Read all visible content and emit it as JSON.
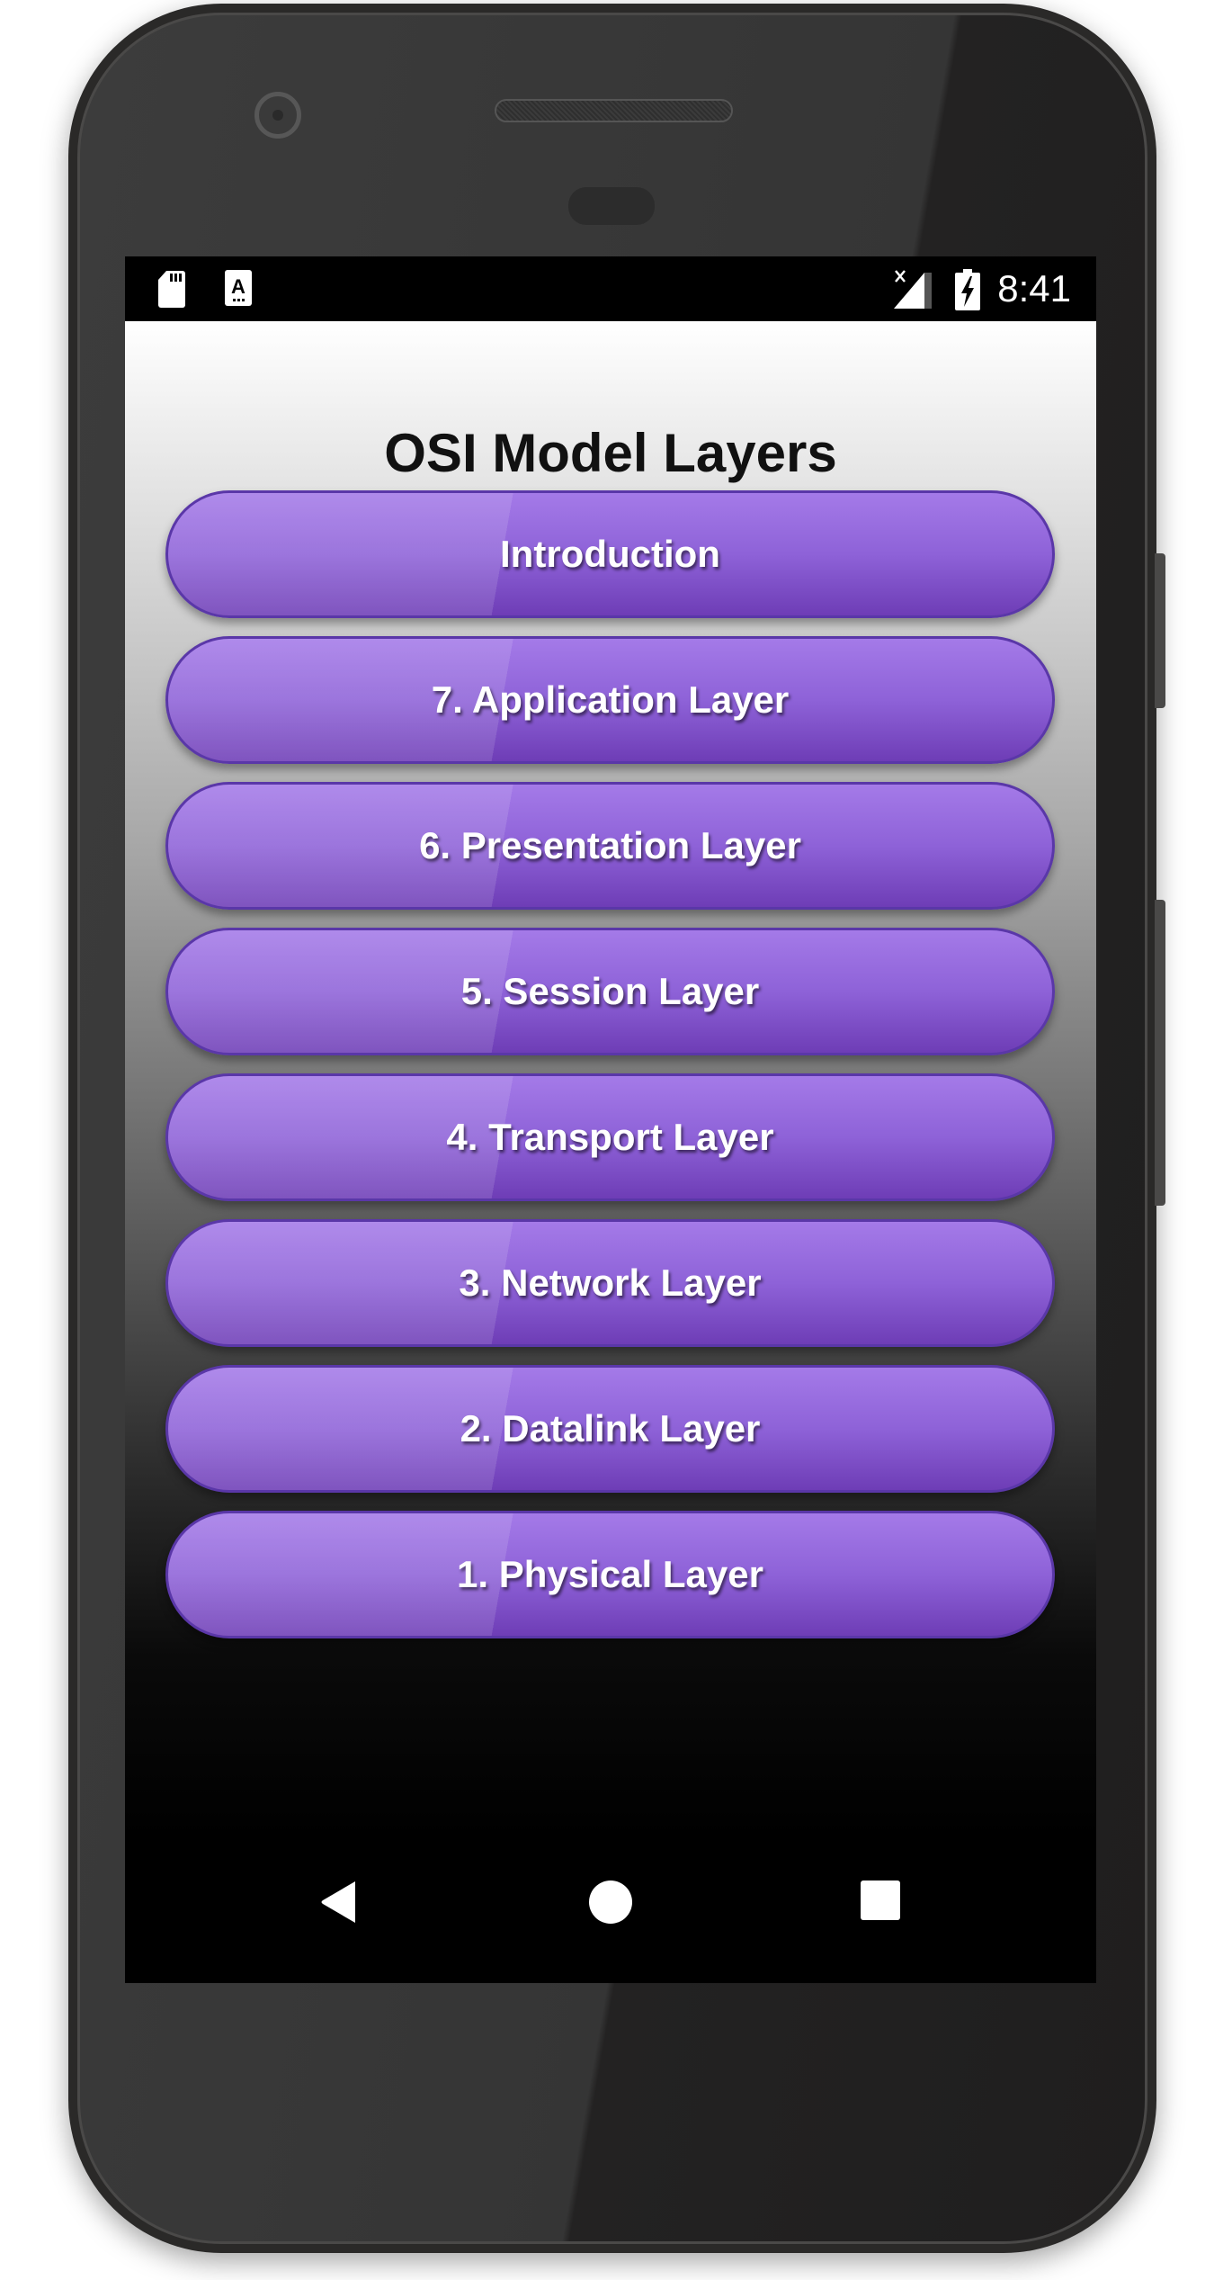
{
  "status_bar": {
    "time": "8:41",
    "left_icons": [
      "sd-card-icon",
      "keyboard-a-icon"
    ],
    "right_icons": [
      "no-signal-icon",
      "battery-charging-icon"
    ]
  },
  "app": {
    "title": "OSI Model Layers",
    "buttons": [
      {
        "label": "Introduction"
      },
      {
        "label": "7. Application Layer"
      },
      {
        "label": "6. Presentation Layer"
      },
      {
        "label": "5. Session Layer"
      },
      {
        "label": "4. Transport Layer"
      },
      {
        "label": "3. Network Layer"
      },
      {
        "label": "2. Datalink Layer"
      },
      {
        "label": "1. Physical Layer"
      }
    ],
    "button_color": "#8e62d8"
  },
  "nav_bar": {
    "icons": [
      "back-icon",
      "home-icon",
      "recents-icon"
    ]
  }
}
